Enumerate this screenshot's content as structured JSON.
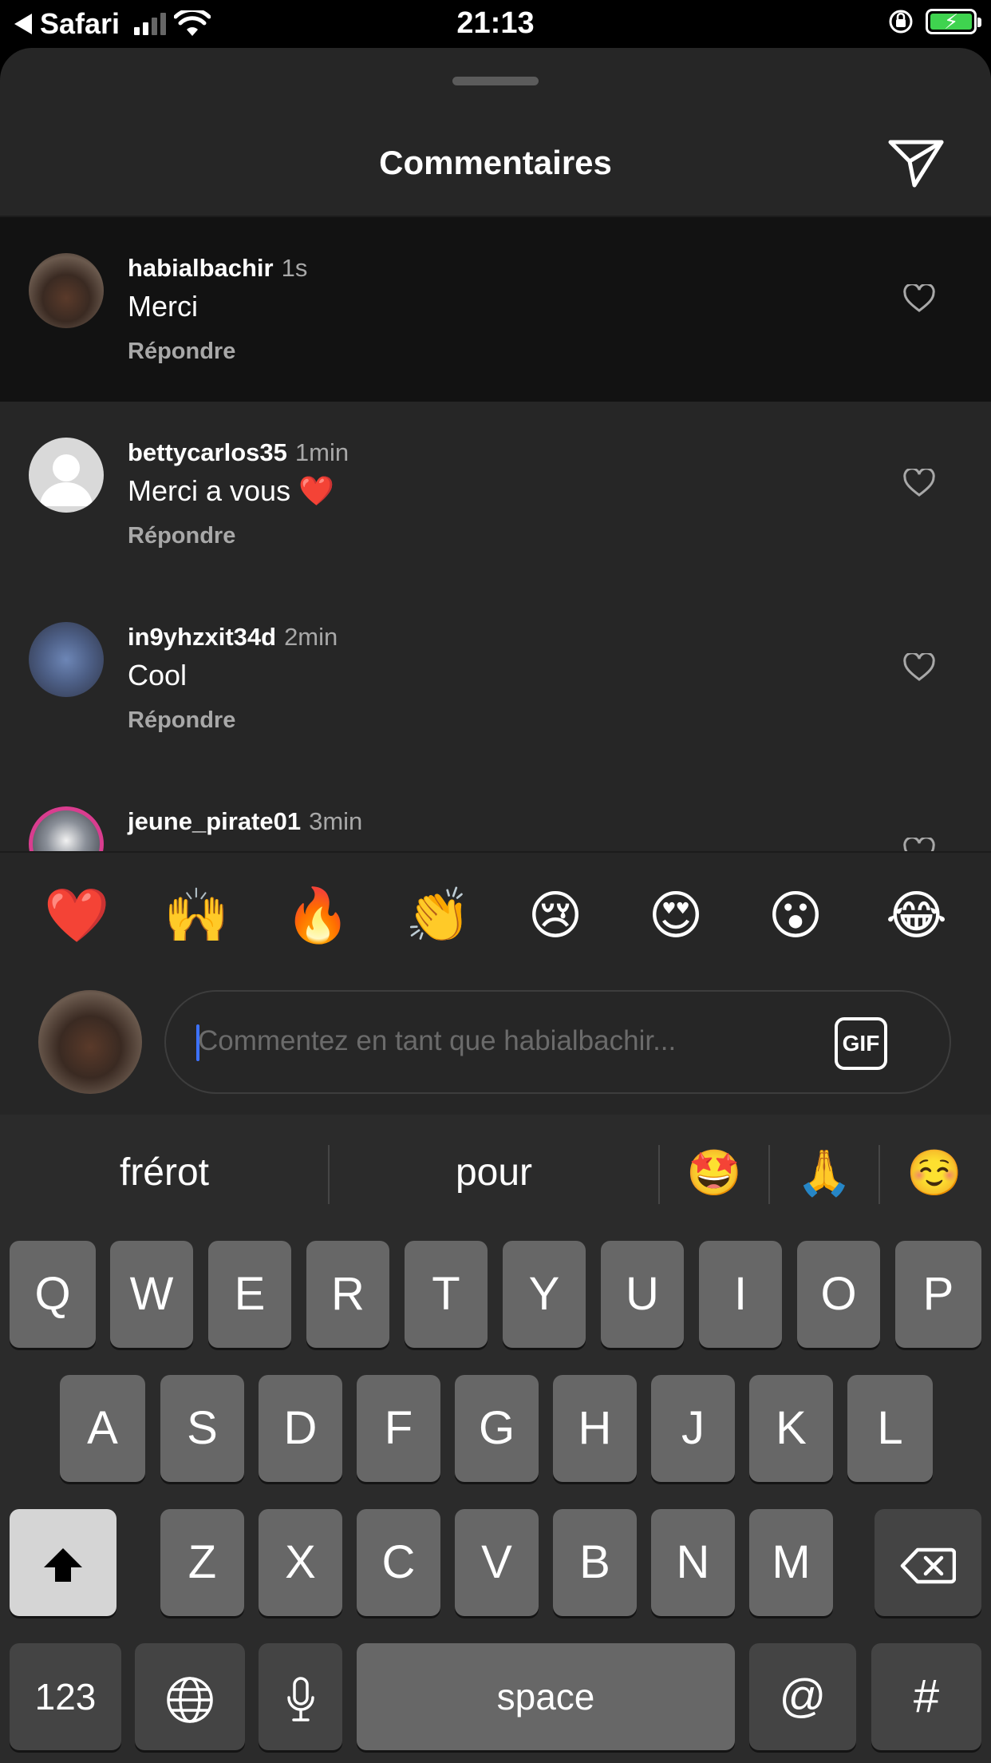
{
  "status_bar": {
    "back_app": "Safari",
    "time": "21:13",
    "battery_color": "#3fd34f"
  },
  "sheet": {
    "title": "Commentaires",
    "send_icon": "paper-plane-icon"
  },
  "comments": [
    {
      "username": "habialbachir",
      "time": "1s",
      "text": "Merci",
      "reply": "Répondre"
    },
    {
      "username": "bettycarlos35",
      "time": "1min",
      "text": "Merci a vous ❤️",
      "reply": "Répondre"
    },
    {
      "username": "in9yhzxit34d",
      "time": "2min",
      "text": "Cool",
      "reply": "Répondre"
    },
    {
      "username": "jeune_pirate01",
      "time": "3min",
      "text": "",
      "reply": ""
    }
  ],
  "reactions": [
    "❤️",
    "🙌",
    "🔥",
    "👏",
    "😢",
    "😍",
    "😮",
    "😂"
  ],
  "composer": {
    "placeholder": "Commentez en tant que habialbachir...",
    "gif_label": "GIF"
  },
  "keyboard": {
    "suggestions": [
      "frérot",
      "pour",
      "🤩",
      "🙏",
      "☺️"
    ],
    "row1": [
      "Q",
      "W",
      "E",
      "R",
      "T",
      "Y",
      "U",
      "I",
      "O",
      "P"
    ],
    "row2": [
      "A",
      "S",
      "D",
      "F",
      "G",
      "H",
      "J",
      "K",
      "L"
    ],
    "row3": [
      "Z",
      "X",
      "C",
      "V",
      "B",
      "N",
      "M"
    ],
    "numbers_label": "123",
    "space_label": "space",
    "at_label": "@",
    "hash_label": "#"
  },
  "colors": {
    "sheet_bg": "#262626",
    "active_comment_bg": "#121212",
    "muted_text": "#a8a8a8",
    "caret": "#3d72ff"
  }
}
